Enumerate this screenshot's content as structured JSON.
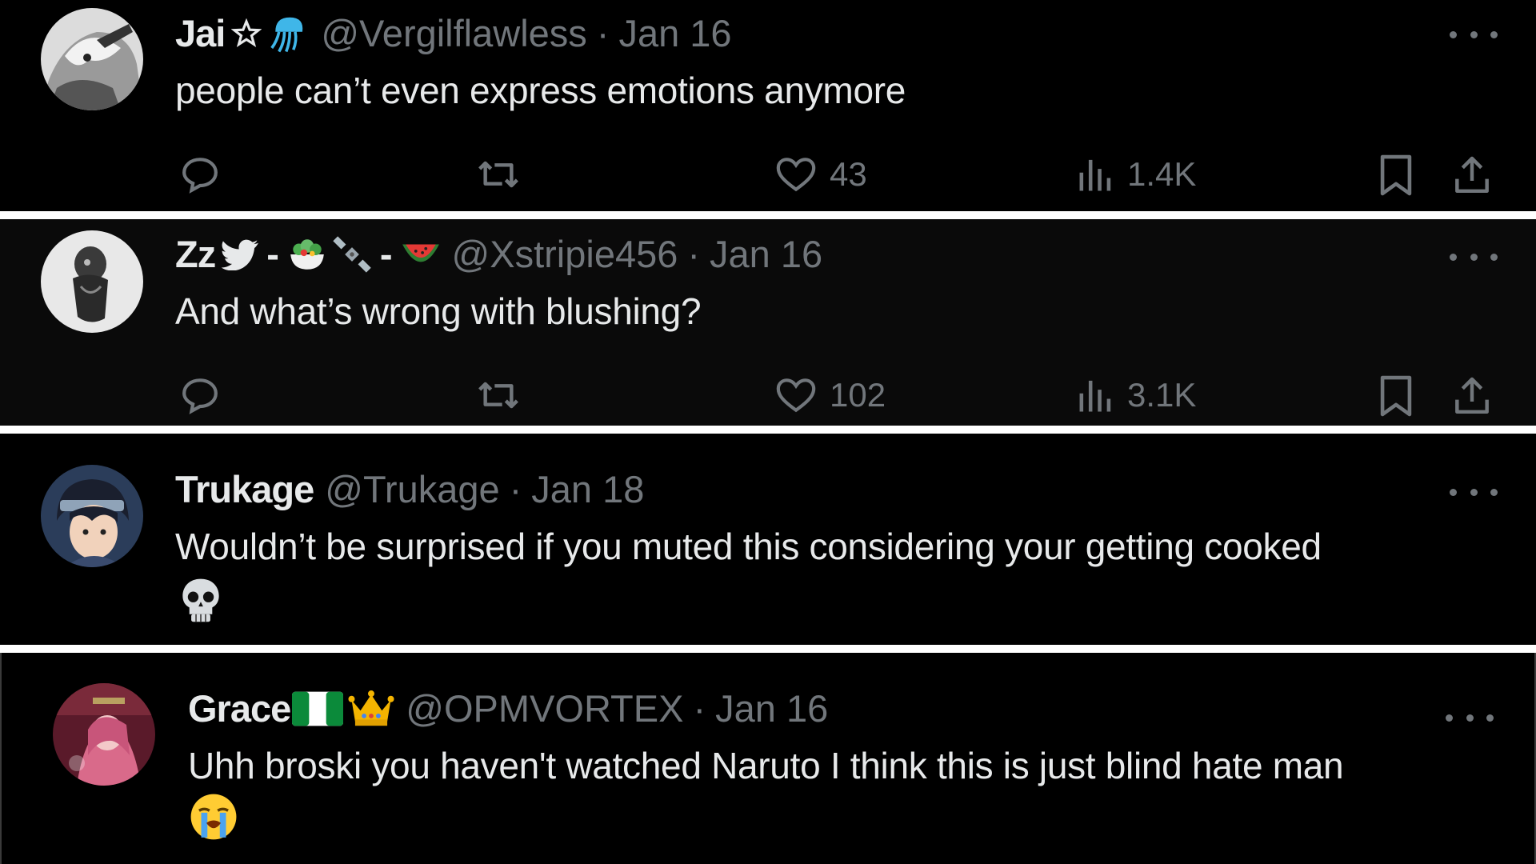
{
  "posts": [
    {
      "name": "Jai",
      "handle": "@Vergilflawless",
      "separator": "·",
      "date": "Jan 16",
      "text": "people can’t even express emotions anymore",
      "likes": "43",
      "views": "1.4K"
    },
    {
      "name": "Zz",
      "handle": "@Xstripie456",
      "separator": "·",
      "date": "Jan 16",
      "text": "And what’s wrong with blushing?",
      "likes": "102",
      "views": "3.1K"
    },
    {
      "name": "Trukage",
      "handle": "@Trukage",
      "separator": "·",
      "date": "Jan 18",
      "text": "Wouldn’t be surprised if you muted this considering your getting cooked"
    },
    {
      "name": "Grace",
      "handle": "@OPMVORTEX",
      "separator": "·",
      "date": "Jan 16",
      "text": "Uhh broski you haven't watched Naruto I think this is just blind hate man"
    }
  ],
  "icons": {
    "reply": "speech-bubble-icon",
    "repost": "repost-arrows-icon",
    "like": "heart-icon",
    "views": "bar-chart-icon",
    "bookmark": "bookmark-icon",
    "share": "share-upload-icon",
    "more": "ellipsis-icon"
  },
  "colors": {
    "background": "#000000",
    "text": "#e7e9ea",
    "muted": "#71767b",
    "divider": "#ffffff"
  }
}
